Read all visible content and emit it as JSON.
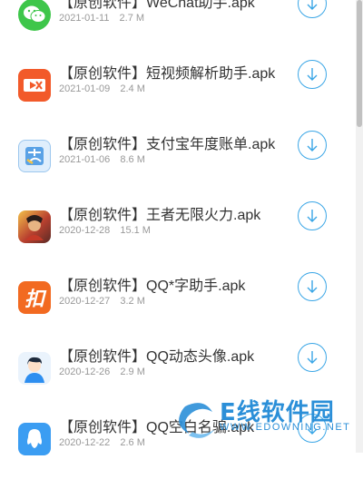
{
  "items": [
    {
      "name": "【原创软件】WeChat助手.apk",
      "date": "2021-01-11",
      "size": "2.7 M",
      "icon": "wechat-icon",
      "color": "#3ec64a"
    },
    {
      "name": "【原创软件】短视频解析助手.apk",
      "date": "2021-01-09",
      "size": "2.4 M",
      "icon": "video-parse-icon",
      "color": "#f25a2a"
    },
    {
      "name": "【原创软件】支付宝年度账单.apk",
      "date": "2021-01-06",
      "size": "8.6 M",
      "icon": "alipay-bill-icon",
      "color": "#5aa2e6"
    },
    {
      "name": "【原创软件】王者无限火力.apk",
      "date": "2020-12-28",
      "size": "15.1 M",
      "icon": "game-icon",
      "color": "#b9412f"
    },
    {
      "name": "【原创软件】QQ*字助手.apk",
      "date": "2020-12-27",
      "size": "3.2 M",
      "icon": "qq-text-icon",
      "color": "#f26a21",
      "glyph": "扣"
    },
    {
      "name": "【原创软件】QQ动态头像.apk",
      "date": "2020-12-26",
      "size": "2.9 M",
      "icon": "avatar-icon",
      "color": "#2d8ef0"
    },
    {
      "name": "【原创软件】QQ空白名骗.apk",
      "date": "2020-12-22",
      "size": "2.6 M",
      "icon": "qq-blank-name-icon",
      "color": "#3b9df2"
    }
  ],
  "watermark": {
    "title": "E线软件园",
    "subtitle": "WWW.EDOWNING.NET",
    "color": "#2b8fd8"
  }
}
